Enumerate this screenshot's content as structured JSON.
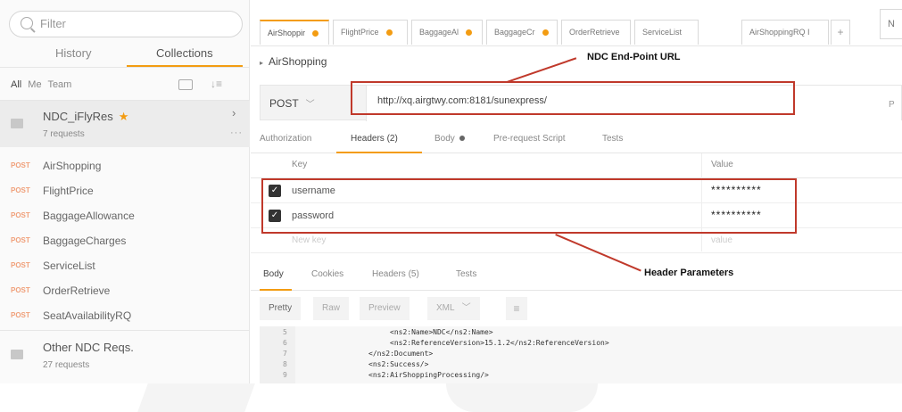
{
  "sidebar": {
    "filter_placeholder": "Filter",
    "tabs": {
      "history": "History",
      "collections": "Collections"
    },
    "filters": {
      "all": "All",
      "me": "Me",
      "team": "Team"
    },
    "collections": [
      {
        "name": "NDC_iFlyRes",
        "count": "7 requests",
        "starred": "★"
      },
      {
        "name": "Other NDC Reqs.",
        "count": "27 requests"
      }
    ],
    "requests": [
      {
        "method": "POST",
        "name": "AirShopping"
      },
      {
        "method": "POST",
        "name": "FlightPrice"
      },
      {
        "method": "POST",
        "name": "BaggageAllowance"
      },
      {
        "method": "POST",
        "name": "BaggageCharges"
      },
      {
        "method": "POST",
        "name": "ServiceList"
      },
      {
        "method": "POST",
        "name": "OrderRetrieve"
      },
      {
        "method": "POST",
        "name": "SeatAvailabilityRQ"
      }
    ],
    "more": "···"
  },
  "tabs": [
    {
      "label": "AirShoppir"
    },
    {
      "label": "FlightPrice"
    },
    {
      "label": "BaggageAl"
    },
    {
      "label": "BaggageCr"
    },
    {
      "label": "OrderRetrieve"
    },
    {
      "label": "ServiceList"
    },
    {
      "label": "AirShoppingRQ I"
    }
  ],
  "new_tab": "+",
  "right_edge": "N",
  "breadcrumb": "AirShopping",
  "request": {
    "method": "POST",
    "url": "http://xq.airgtwy.com:8181/sunexpress/",
    "params_edge": "P"
  },
  "request_tabs": {
    "authorization": "Authorization",
    "headers": "Headers (2)",
    "body": "Body",
    "prerequest": "Pre-request Script",
    "tests": "Tests"
  },
  "headers_table": {
    "key_col": "Key",
    "value_col": "Value",
    "rows": [
      {
        "key": "username",
        "value": "**********"
      },
      {
        "key": "password",
        "value": "**********"
      }
    ],
    "new_key_placeholder": "New key",
    "new_value_placeholder": "value"
  },
  "response_tabs": {
    "body": "Body",
    "cookies": "Cookies",
    "headers": "Headers (5)",
    "tests": "Tests"
  },
  "format": {
    "pretty": "Pretty",
    "raw": "Raw",
    "preview": "Preview",
    "type": "XML"
  },
  "code_lines": [
    {
      "n": "5",
      "text": "<ns2:Name>NDC</ns2:Name>"
    },
    {
      "n": "6",
      "text": "<ns2:ReferenceVersion>15.1.2</ns2:ReferenceVersion>"
    },
    {
      "n": "7",
      "text": "</ns2:Document>"
    },
    {
      "n": "8",
      "text": "<ns2:Success/>"
    },
    {
      "n": "9",
      "text": "<ns2:AirShoppingProcessing/>"
    }
  ],
  "annotations": {
    "endpoint": "NDC End-Point URL",
    "headers": "Header Parameters"
  },
  "colors": {
    "accent": "#f39c12",
    "annotation": "#c0392b"
  }
}
